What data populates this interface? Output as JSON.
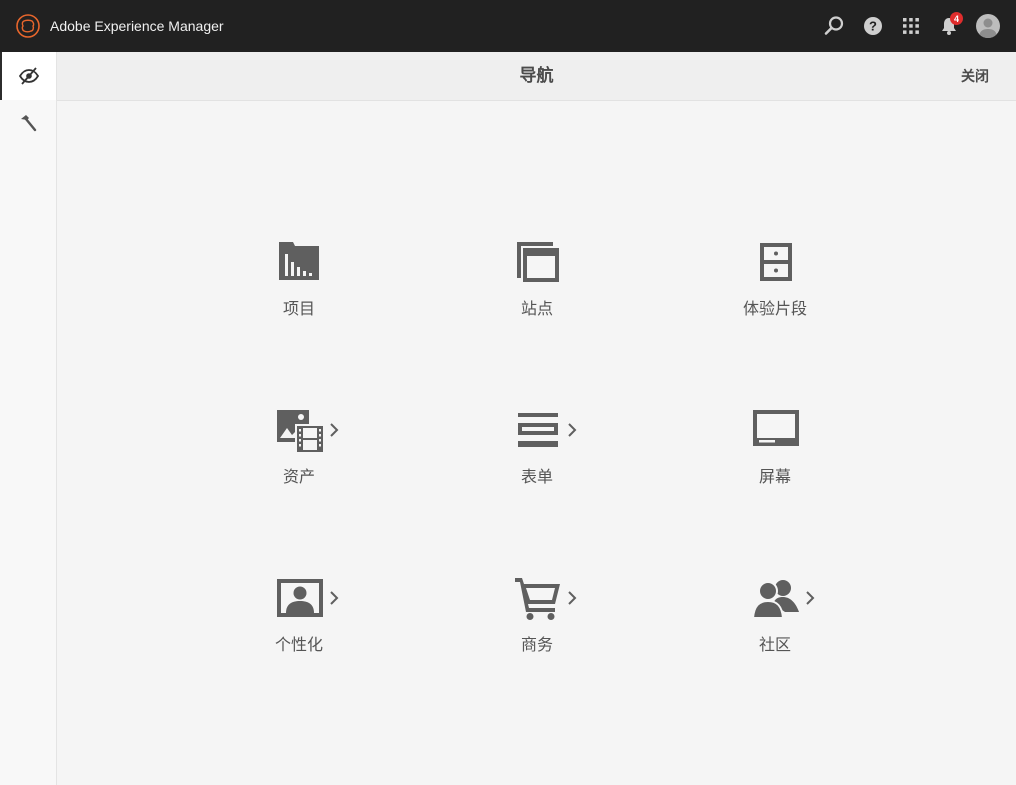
{
  "app": {
    "title": "Adobe Experience Manager"
  },
  "topbar": {
    "icons": [
      "search-icon",
      "help-icon",
      "apps-grid-icon",
      "bell-icon",
      "user-avatar"
    ],
    "notifications_count": "4"
  },
  "rail": {
    "items": [
      {
        "icon": "navigation-eye-icon",
        "active": true
      },
      {
        "icon": "tools-hammer-icon",
        "active": false
      }
    ]
  },
  "header": {
    "title": "导航",
    "close_label": "关闭"
  },
  "tiles": [
    {
      "label": "项目",
      "icon": "projects-icon",
      "has_chevron": false
    },
    {
      "label": "站点",
      "icon": "sites-icon",
      "has_chevron": false
    },
    {
      "label": "体验片段",
      "icon": "experience-fragments-icon",
      "has_chevron": false
    },
    {
      "label": "资产",
      "icon": "assets-icon",
      "has_chevron": true
    },
    {
      "label": "表单",
      "icon": "forms-icon",
      "has_chevron": true
    },
    {
      "label": "屏幕",
      "icon": "screens-icon",
      "has_chevron": false
    },
    {
      "label": "个性化",
      "icon": "personalization-icon",
      "has_chevron": true
    },
    {
      "label": "商务",
      "icon": "commerce-cart-icon",
      "has_chevron": true
    },
    {
      "label": "社区",
      "icon": "communities-icon",
      "has_chevron": true
    }
  ],
  "colors": {
    "topbar_bg": "#212121",
    "icon_gray": "#5f5f5f",
    "page_bg": "#f5f5f5",
    "badge_red": "#e02d2d"
  }
}
